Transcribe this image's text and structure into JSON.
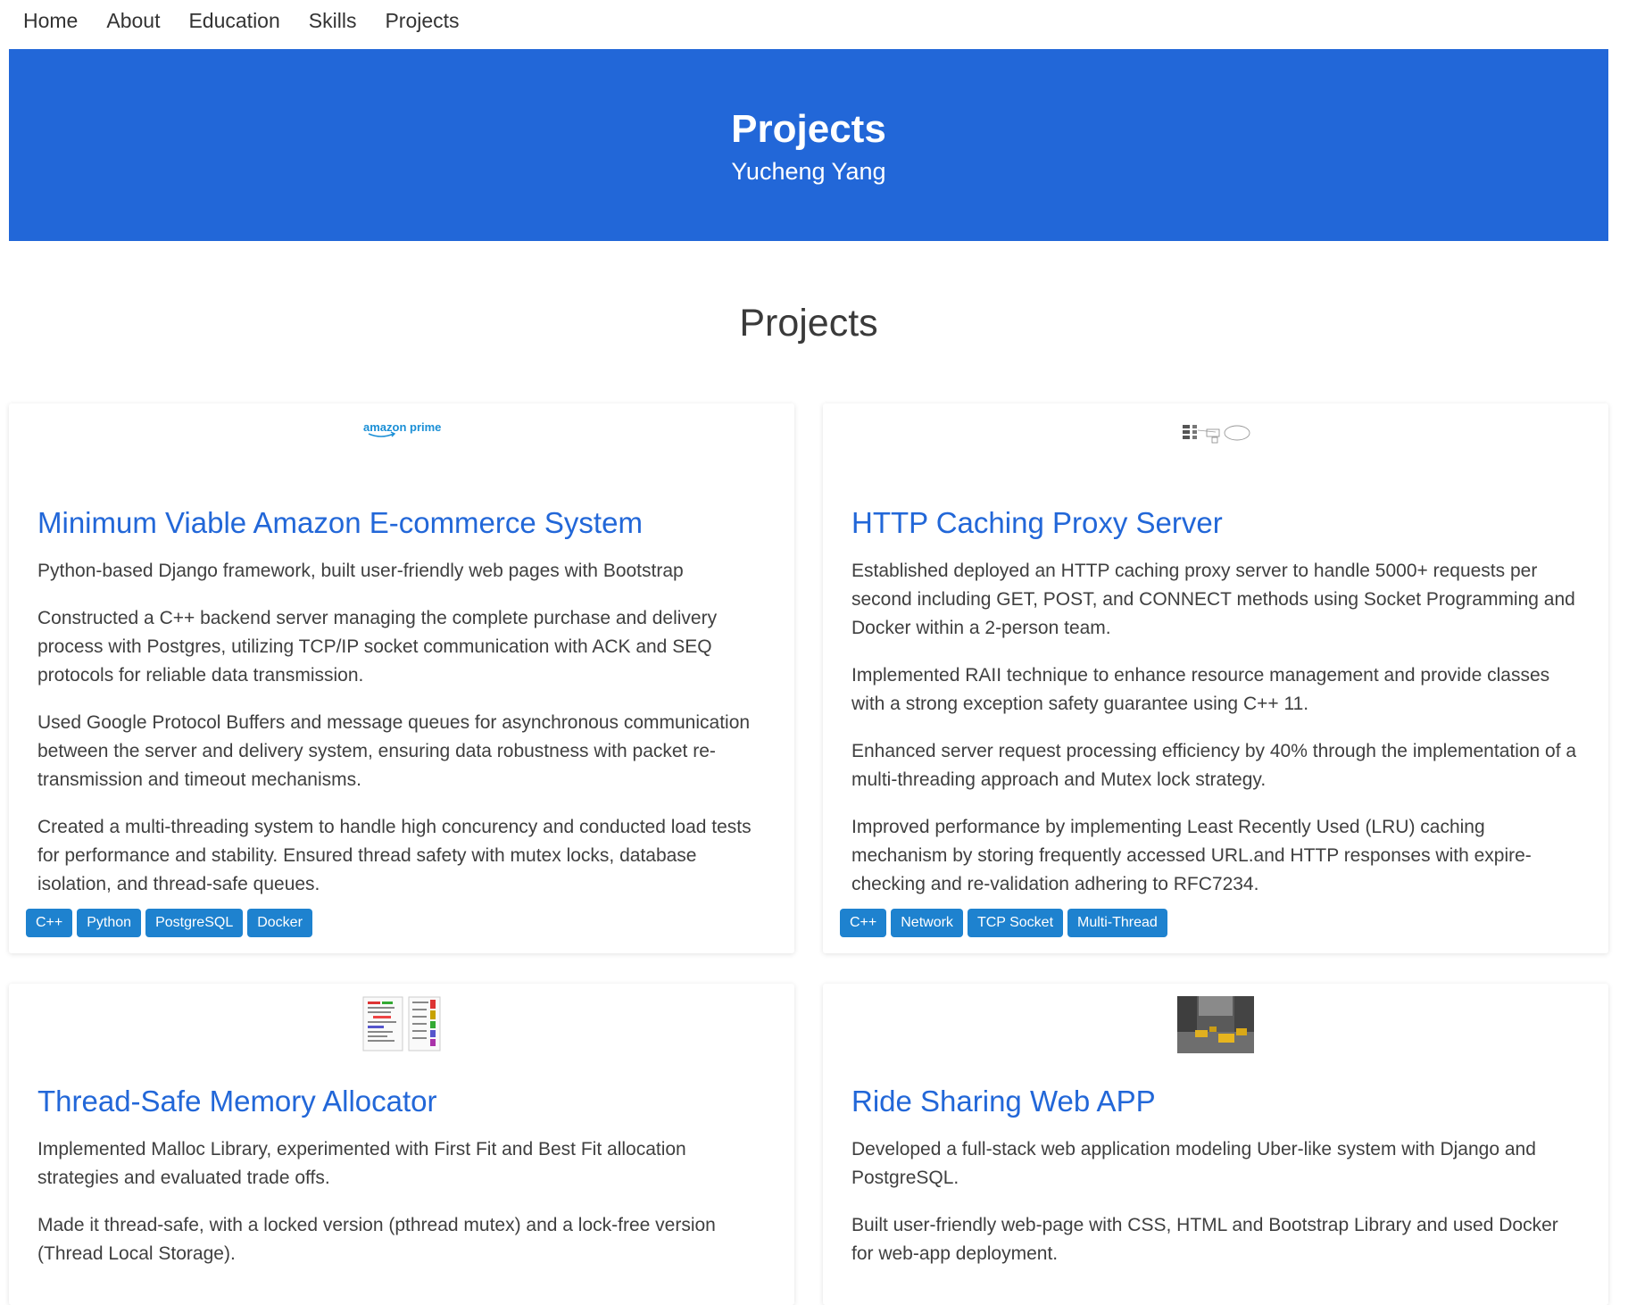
{
  "nav": [
    "Home",
    "About",
    "Education",
    "Skills",
    "Projects"
  ],
  "hero": {
    "title": "Projects",
    "subtitle": "Yucheng Yang"
  },
  "section_title": "Projects",
  "colors": {
    "primary": "#2267d8",
    "tag": "#1e82cf"
  },
  "projects": [
    {
      "image": "amazon-prime-logo",
      "image_text": "amazon prime",
      "title": "Minimum Viable Amazon E-commerce System",
      "paragraphs": [
        "Python-based Django framework, built user-friendly web pages with Bootstrap",
        "Constructed a C++ backend server managing the complete purchase and delivery process with Postgres, utilizing TCP/IP socket communication with ACK and SEQ protocols for reliable data transmission.",
        "Used Google Protocol Buffers and message queues for asynchronous communication between the server and delivery system, ensuring data robustness with packet re-transmission and timeout mechanisms.",
        "Created a multi-threading system to handle high concurency and conducted load tests for performance and stability. Ensured thread safety with mutex locks, database isolation, and thread-safe queues."
      ],
      "tags": [
        "C++",
        "Python",
        "PostgreSQL",
        "Docker"
      ]
    },
    {
      "image": "proxy-diagram-thumbnail",
      "title": "HTTP Caching Proxy Server",
      "paragraphs": [
        "Established deployed an HTTP caching proxy server to handle 5000+ requests per second including GET, POST, and CONNECT methods using Socket Programming and Docker within a 2-person team.",
        "Implemented RAII technique to enhance resource management and provide classes with a strong exception safety guarantee using C++ 11.",
        "Enhanced server request processing efficiency by 40% through the implementation of a multi-threading approach and Mutex lock strategy.",
        "Improved performance by implementing Least Recently Used (LRU) caching mechanism by storing frequently accessed URL.and HTTP responses with expire-checking and re-validation adhering to RFC7234."
      ],
      "tags": [
        "C++",
        "Network",
        "TCP Socket",
        "Multi-Thread"
      ]
    },
    {
      "image": "memory-allocator-thumbnail",
      "title": "Thread-Safe Memory Allocator",
      "paragraphs": [
        "Implemented Malloc Library, experimented with First Fit and Best Fit allocation strategies and evaluated trade offs.",
        "Made it thread-safe, with a locked version (pthread mutex) and a lock-free version (Thread Local Storage)."
      ],
      "tags": []
    },
    {
      "image": "street-taxi-photo",
      "title": "Ride Sharing Web APP",
      "paragraphs": [
        "Developed a full-stack web application modeling Uber-like system with Django and PostgreSQL.",
        "Built user-friendly web-page with CSS, HTML and Bootstrap Library and used Docker for web-app deployment."
      ],
      "tags": []
    }
  ]
}
